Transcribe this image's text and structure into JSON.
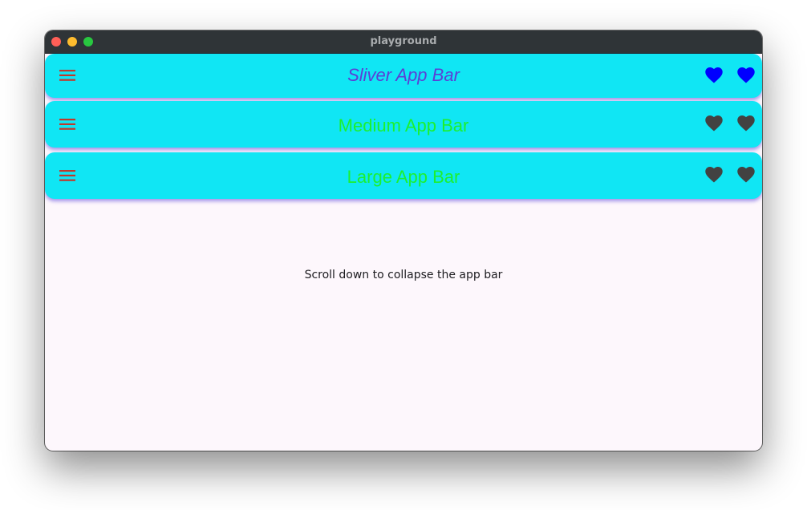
{
  "window": {
    "title": "playground"
  },
  "app_bars": [
    {
      "title": "Sliver App Bar",
      "title_color": "#5b3fd6",
      "title_style": "italic",
      "leading_icon": "menu-icon",
      "leading_color": "#c0392b",
      "actions": [
        "favorite-icon",
        "favorite-icon"
      ],
      "action_color": "#0000ff"
    },
    {
      "title": "Medium App Bar",
      "title_color": "#1cf02f",
      "leading_icon": "menu-icon",
      "leading_color": "#c0392b",
      "actions": [
        "favorite-icon",
        "favorite-icon"
      ],
      "action_color": "#424242"
    },
    {
      "title": "Large App Bar",
      "title_color": "#1cf02f",
      "leading_icon": "menu-icon",
      "leading_color": "#c0392b",
      "actions": [
        "favorite-icon",
        "favorite-icon"
      ],
      "action_color": "#424242"
    }
  ],
  "colors": {
    "app_bar_background": "#10e6f4",
    "app_bar_shadow": "#5b46dc",
    "body_background": "#fdf7fc"
  },
  "body": {
    "message": "Scroll down to collapse the app bar"
  }
}
